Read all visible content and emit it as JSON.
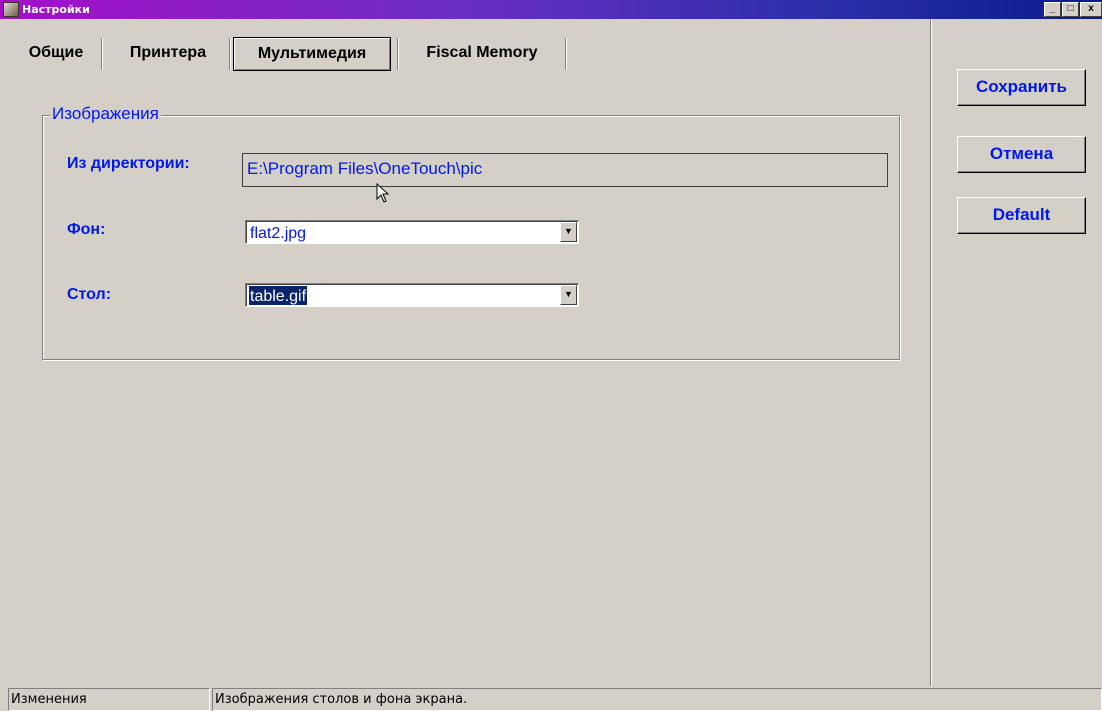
{
  "window": {
    "title": "Настройки",
    "controls": {
      "minimize": "_",
      "maximize": "□",
      "close": "x"
    }
  },
  "tabs": [
    {
      "label": "Общие",
      "active": false
    },
    {
      "label": "Принтера",
      "active": false
    },
    {
      "label": "Мультимедия",
      "active": true
    },
    {
      "label": "Fiscal Memory",
      "active": false
    }
  ],
  "images_group": {
    "title": "Изображения",
    "directory": {
      "label": "Из директории:",
      "value": "E:\\Program Files\\OneTouch\\pic"
    },
    "background": {
      "label": "Фон:",
      "value": "flat2.jpg"
    },
    "table": {
      "label": "Стол:",
      "value": "table.gif"
    }
  },
  "actions": {
    "save": "Сохранить",
    "cancel": "Отмена",
    "default": "Default"
  },
  "statusbar": {
    "left": "Изменения",
    "right": "Изображения столов и фона экрана."
  },
  "colors": {
    "face": "#d4d0c8",
    "label_blue": "#0018e8",
    "selection": "#0a246a"
  }
}
